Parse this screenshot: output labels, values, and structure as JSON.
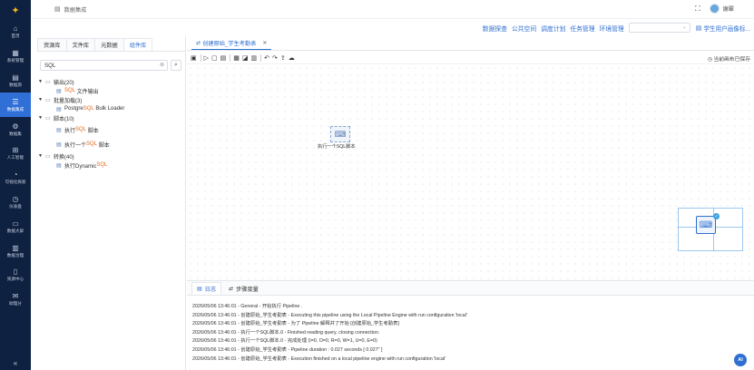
{
  "app": {
    "logo_icon": "star-logo-icon"
  },
  "rail": {
    "items": [
      {
        "icon": "⌂",
        "label": "首页",
        "name": "rail-item-home",
        "active": false
      },
      {
        "icon": "▦",
        "label": "系统管理",
        "name": "rail-item-system",
        "active": false
      },
      {
        "icon": "▤",
        "label": "数据源",
        "name": "rail-item-datasource",
        "active": false
      },
      {
        "icon": "☰",
        "label": "数据集成",
        "name": "rail-item-integration",
        "active": true
      },
      {
        "icon": "⚙",
        "label": "数据集",
        "name": "rail-item-dataset",
        "active": false
      },
      {
        "icon": "⊞",
        "label": "人工智能",
        "name": "rail-item-ai",
        "active": false
      },
      {
        "icon": "◔",
        "label": "可视化探索",
        "name": "rail-item-visual",
        "active": false
      },
      {
        "icon": "◷",
        "label": "仪表盘",
        "name": "rail-item-dashboard",
        "active": false
      },
      {
        "icon": "▭",
        "label": "数据大屏",
        "name": "rail-item-bigscreen",
        "active": false
      },
      {
        "icon": "▥",
        "label": "数据治理",
        "name": "rail-item-governance",
        "active": false
      },
      {
        "icon": "▯",
        "label": "资源中心",
        "name": "rail-item-resource",
        "active": false
      },
      {
        "icon": "✉",
        "label": "助理分",
        "name": "rail-item-assistant",
        "active": false
      }
    ],
    "collapse_icon": "«"
  },
  "topbar": {
    "title": "数据集成",
    "title_icon": "▤",
    "expand_icon": "⛶",
    "username": "谢翠"
  },
  "subnav": {
    "links": [
      "数据探查",
      "公共空间",
      "调度计划",
      "任务管理",
      "环境管理"
    ],
    "select_value": "",
    "user_label": "学生用户画像标..."
  },
  "left_panel": {
    "tabs": [
      "资源库",
      "文件库",
      "元数据",
      "组件库"
    ],
    "active_tab": 3,
    "search_value": "SQL",
    "tree": [
      {
        "label": "输出(20)",
        "children": [
          {
            "prefix": "",
            "hl": "SQL",
            "suffix": " 文件输出"
          }
        ]
      },
      {
        "label": "批量加载(3)",
        "children": [
          {
            "prefix": "Postgre ",
            "hl": "SQL",
            "suffix": " Bulk Loader"
          }
        ]
      },
      {
        "label": "脚本(10)",
        "children": [
          {
            "prefix": "执行 ",
            "hl": "SQL",
            "suffix": " 脚本"
          },
          {
            "prefix": "执行一个 ",
            "hl": "SQL",
            "suffix": " 脚本"
          }
        ]
      },
      {
        "label": "转换(40)",
        "children": [
          {
            "prefix": "执行Dynamic ",
            "hl": "SQL",
            "suffix": ""
          }
        ]
      }
    ]
  },
  "canvas": {
    "tab_label": "创建原始_学生考勤表",
    "saved_label": "当前画布已保存",
    "step_label": "执行一个SQL脚本"
  },
  "log": {
    "tabs": [
      "日志",
      "步骤度量"
    ],
    "lines": [
      "2026/05/06 13:46:01 - General - 开始执行 Pipeline .",
      "2026/05/06 13:46:01 - 创建原始_学生考勤表 - Executing this pipeline using the Local Pipeline Engine with run configuration 'local'",
      "2026/05/06 13:46:01 - 创建原始_学生考勤表 - 为了 Pipeline 解释并了开始 [创建原始_学生考勤表]",
      "2026/05/06 13:46:01 - 执行一个SQL脚本.0 - Finished reading query, closing connection.",
      "2026/05/06 13:46:01 - 执行一个SQL脚本.0 - 完成处理 (I=0, O=0, R=0, W=1, U=0, E=0)",
      "2026/05/06 13:46:01 - 创建原始_学生考勤表 - Pipeline duration : 0.027 seconds [  0.027\" ]",
      "2026/05/06 13:46:01 - 创建原始_学生考勤表 - Execution finished on a local pipeline engine with run configuration 'local'"
    ]
  },
  "ai_badge": "AI",
  "colors": {
    "rail_bg": "#0f2140",
    "accent": "#2e6fd1",
    "highlight": "#e5661a"
  }
}
